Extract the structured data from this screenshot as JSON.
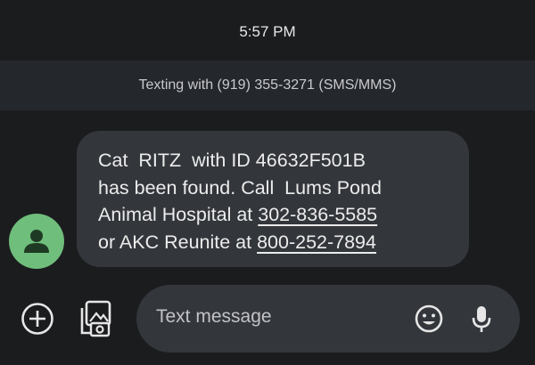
{
  "status_bar": {
    "time": "5:57 PM"
  },
  "conversation": {
    "header": "Texting with (919) 355-3271 (SMS/MMS)"
  },
  "message": {
    "line1": "Cat  RITZ  with ID 46632F501B",
    "line2": "has been found. Call  Lums Pond",
    "line3_prefix": "Animal Hospital at ",
    "link1": "302-836-5585",
    "line4_prefix": "or AKC Reunite at ",
    "link2": "800-252-7894"
  },
  "composer": {
    "placeholder": "Text message",
    "icons": [
      "add-icon",
      "gallery-icon",
      "emoji-icon",
      "mic-icon"
    ]
  },
  "colors": {
    "background": "#1b1c1e",
    "banner": "#24272c",
    "bubble": "#33363b",
    "avatar": "#6fbe7c"
  }
}
